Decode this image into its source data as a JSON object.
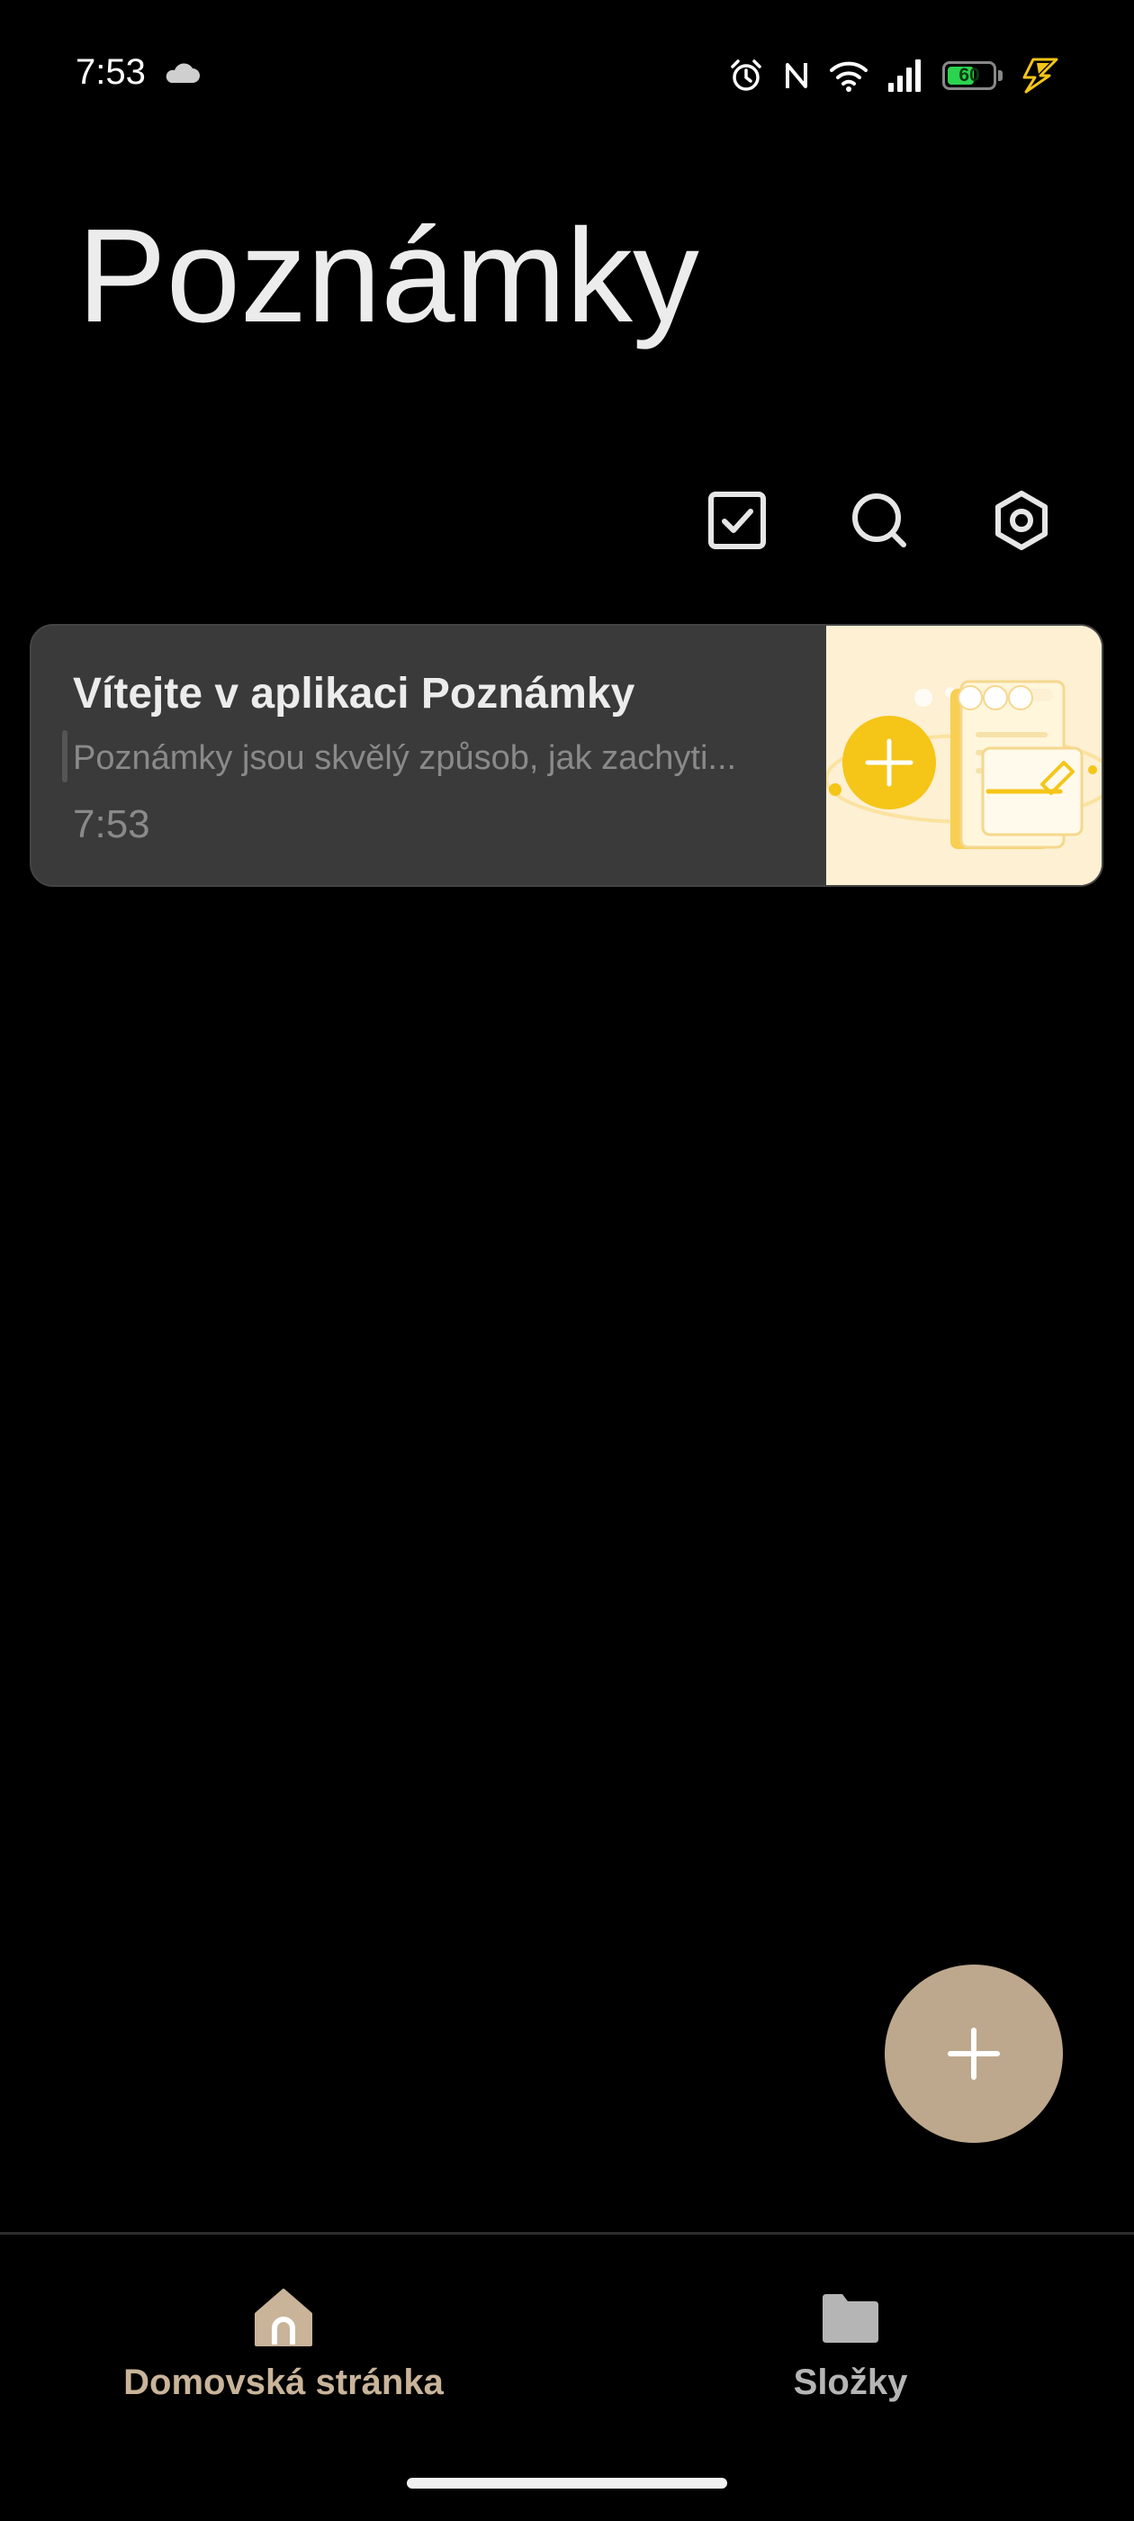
{
  "status_bar": {
    "time": "7:53",
    "battery_level": "60",
    "icons": [
      "cloud-icon",
      "alarm-icon",
      "nfc-icon",
      "wifi-icon",
      "signal-icon",
      "battery-icon",
      "charging-icon"
    ]
  },
  "header": {
    "title": "Poznámky"
  },
  "toolbar": {
    "icons": [
      "checkbox-select-icon",
      "search-icon",
      "settings-icon"
    ]
  },
  "notes": [
    {
      "title": "Vítejte v aplikaci Poznámky",
      "preview": "Poznámky jsou skvělý způsob, jak zachyti...",
      "time": "7:53"
    }
  ],
  "fab": {
    "icon": "plus-icon"
  },
  "bottom_nav": {
    "items": [
      {
        "label": "Domovská stránka",
        "icon": "home-icon",
        "active": true
      },
      {
        "label": "Složky",
        "icon": "folder-icon",
        "active": false
      }
    ]
  },
  "colors": {
    "background": "#000000",
    "card": "#3a3a3a",
    "accent": "#bda88d",
    "active_nav": "#c9b49a",
    "battery_green": "#2bd44f",
    "charging_yellow": "#f5c518"
  }
}
